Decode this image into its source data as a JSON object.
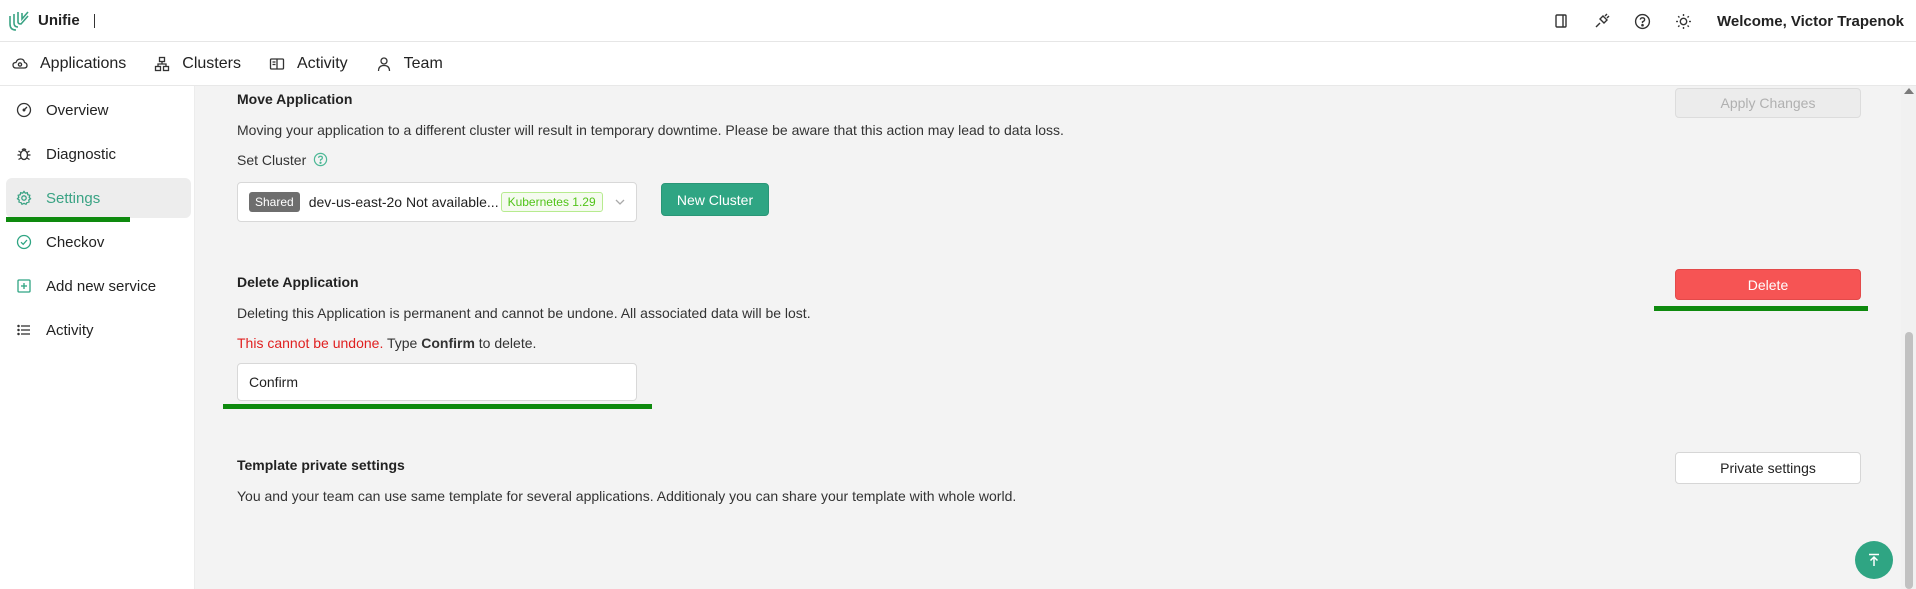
{
  "header": {
    "brand": "Unifie",
    "welcome": "Welcome, Victor Trapenok",
    "icons": [
      "book-icon",
      "plug-icon",
      "help-circle-icon",
      "sun-icon"
    ]
  },
  "nav": {
    "items": [
      {
        "label": "Applications",
        "icon": "cloud-icon"
      },
      {
        "label": "Clusters",
        "icon": "cluster-icon"
      },
      {
        "label": "Activity",
        "icon": "book-open-icon"
      },
      {
        "label": "Team",
        "icon": "user-icon"
      }
    ]
  },
  "sidebar": {
    "items": [
      {
        "label": "Overview",
        "icon": "dashboard-icon"
      },
      {
        "label": "Diagnostic",
        "icon": "bug-icon"
      },
      {
        "label": "Settings",
        "icon": "gear-icon",
        "active": true
      },
      {
        "label": "Checkov",
        "icon": "check-circle-icon"
      },
      {
        "label": "Add new service",
        "icon": "plus-square-icon"
      },
      {
        "label": "Activity",
        "icon": "list-icon"
      }
    ]
  },
  "move": {
    "title": "Move Application",
    "description": "Moving your application to a different cluster will result in temporary downtime. Please be aware that this action may lead to data loss.",
    "set_cluster_label": "Set Cluster",
    "cluster_tag": "Shared",
    "cluster_name": "dev-us-east-2o Not available...",
    "k8s_tag": "Kubernetes 1.29",
    "new_cluster_label": "New Cluster",
    "apply_label": "Apply Changes"
  },
  "delete": {
    "title": "Delete Application",
    "description": "Deleting this Application is permanent and cannot be undone. All associated data will be lost.",
    "warning_red": "This cannot be undone.",
    "warning_pre": "Type",
    "warning_word": "Confirm",
    "warning_post": "to delete.",
    "input_value": "Confirm",
    "delete_label": "Delete"
  },
  "template": {
    "title": "Template private settings",
    "description": "You and your team can use same template for several applications. Additionaly you can share your template with whole world.",
    "button_label": "Private settings"
  },
  "colors": {
    "accent": "#2fa583",
    "danger": "#f65454",
    "highlight_underline": "#0e8a0e"
  }
}
